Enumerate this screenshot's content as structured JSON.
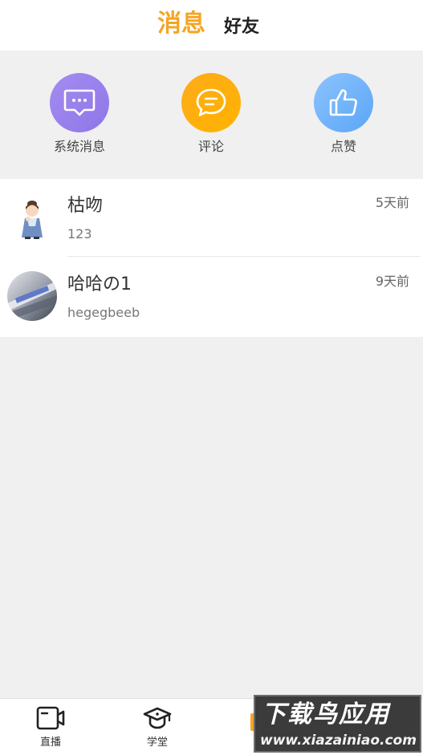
{
  "header": {
    "tab_messages": "消息",
    "tab_friends": "好友"
  },
  "categories": [
    {
      "label": "系统消息",
      "icon": "message-dots-icon",
      "color": "#9b84ee"
    },
    {
      "label": "评论",
      "icon": "comment-icon",
      "color": "#ffad14"
    },
    {
      "label": "点赞",
      "icon": "thumbs-up-icon",
      "color": "#74b4fa"
    }
  ],
  "conversations": [
    {
      "name": "枯吻",
      "preview": "123",
      "time": "5天前",
      "avatar": "cartoon-girl-avatar"
    },
    {
      "name": "哈哈の1",
      "preview": "hegegbeeb",
      "time": "9天前",
      "avatar": "blurred-photo-avatar"
    }
  ],
  "tabbar": [
    {
      "label": "直播",
      "icon": "live-camera-icon"
    },
    {
      "label": "学堂",
      "icon": "graduation-cap-icon"
    }
  ],
  "watermark": {
    "title": "下载鸟应用",
    "url": "www.xiazainiao.com"
  }
}
